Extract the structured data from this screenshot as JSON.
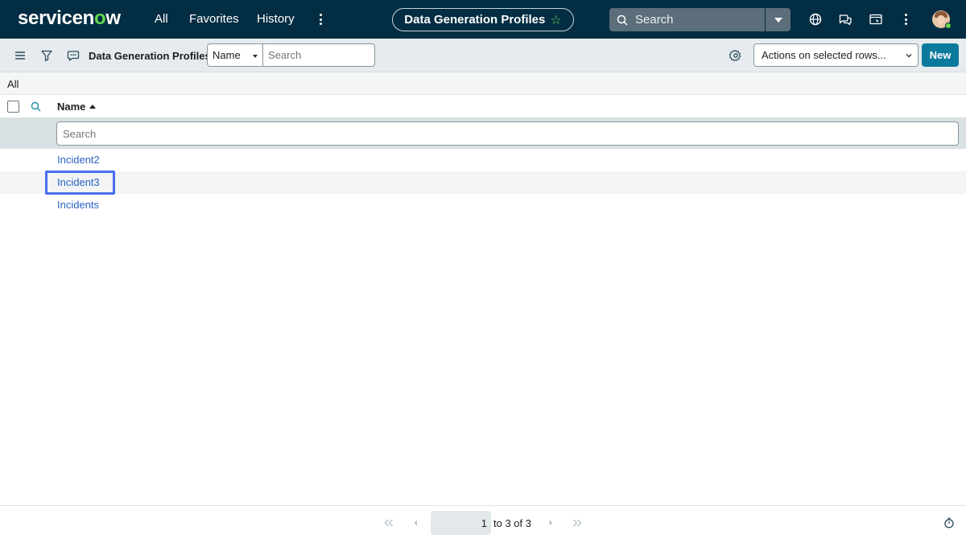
{
  "topnav": {
    "logo": "servicenow",
    "links": {
      "all": "All",
      "favorites": "Favorites",
      "history": "History"
    },
    "context_pill": "Data Generation Profiles",
    "search_placeholder": "Search"
  },
  "toolbar": {
    "title": "Data Generation Profiles",
    "field_select_value": "Name",
    "search_placeholder": "Search",
    "actions_select_value": "Actions on selected rows...",
    "new_label": "New"
  },
  "breadcrumb": "All",
  "table": {
    "column_name": "Name",
    "filter_placeholder": "Search",
    "rows": [
      "Incident2",
      "Incident3",
      "Incidents"
    ]
  },
  "pagination": {
    "current": "1",
    "range_text": "to 3 of 3"
  },
  "colors": {
    "nav_bg": "#032d42",
    "accent_green": "#62d84e",
    "link_blue": "#2a63c4",
    "primary_button": "#0c7a9c",
    "highlight": "#4a6ef0"
  }
}
